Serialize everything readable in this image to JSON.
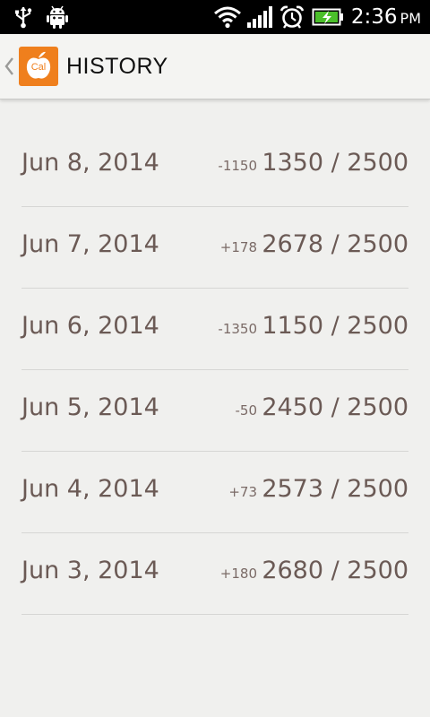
{
  "status_bar": {
    "icons": [
      "usb-icon",
      "android-debug-icon",
      "wifi-icon",
      "signal-icon",
      "alarm-icon",
      "battery-charging-icon"
    ],
    "time": "2:36",
    "ampm": "PM"
  },
  "action_bar": {
    "title": "HISTORY",
    "logo_text": "Cal",
    "logo_color": "#ef7f1d"
  },
  "history": [
    {
      "date": "Jun 8, 2014",
      "delta": "-1150",
      "total": "1350 / 2500"
    },
    {
      "date": "Jun 7, 2014",
      "delta": "+178",
      "total": "2678 / 2500"
    },
    {
      "date": "Jun 6, 2014",
      "delta": "-1350",
      "total": "1150 / 2500"
    },
    {
      "date": "Jun 5, 2014",
      "delta": "-50",
      "total": "2450 / 2500"
    },
    {
      "date": "Jun 4, 2014",
      "delta": "+73",
      "total": "2573 / 2500"
    },
    {
      "date": "Jun 3, 2014",
      "delta": "+180",
      "total": "2680 / 2500"
    }
  ],
  "colors": {
    "background": "#f0f0ee",
    "text": "#6b5a55",
    "divider": "#d6d6d4",
    "accent": "#ef7f1d"
  }
}
